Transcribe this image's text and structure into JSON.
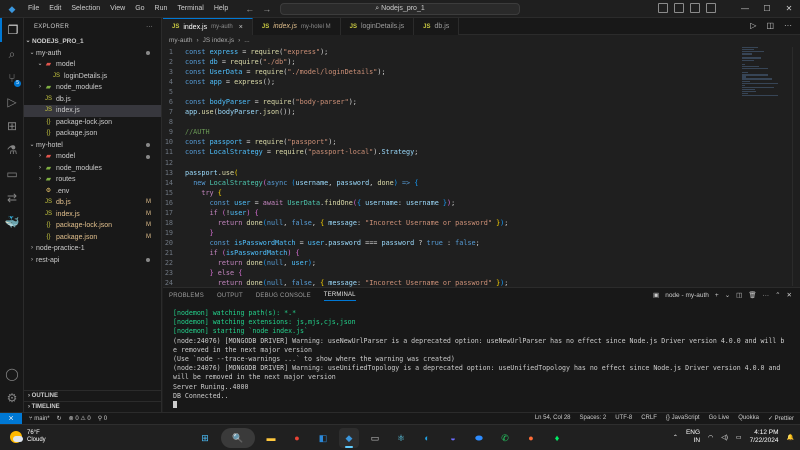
{
  "titlebar": {
    "menu": [
      "File",
      "Edit",
      "Selection",
      "View",
      "Go",
      "Run",
      "Terminal",
      "Help"
    ],
    "search": "Nodejs_pro_1"
  },
  "activitybar": {
    "scm_badge": "5"
  },
  "sidebar": {
    "title": "EXPLORER",
    "root": "NODEJS_PRO_1",
    "rows": [
      {
        "indent": 0,
        "chev": "v",
        "icon": "folder",
        "label": "my-auth",
        "mark": "",
        "color": "",
        "dot": true
      },
      {
        "indent": 1,
        "chev": "v",
        "icon": "folder-red",
        "label": "model",
        "mark": "",
        "color": ""
      },
      {
        "indent": 2,
        "chev": "",
        "icon": "js",
        "label": "loginDetails.js",
        "mark": "",
        "color": ""
      },
      {
        "indent": 1,
        "chev": ">",
        "icon": "folder-green",
        "label": "node_modules",
        "mark": "",
        "color": ""
      },
      {
        "indent": 1,
        "chev": "",
        "icon": "js",
        "label": "db.js",
        "mark": "",
        "color": ""
      },
      {
        "indent": 1,
        "chev": "",
        "icon": "js",
        "label": "index.js",
        "mark": "",
        "color": "",
        "selected": true
      },
      {
        "indent": 1,
        "chev": "",
        "icon": "json",
        "label": "package-lock.json",
        "mark": "",
        "color": ""
      },
      {
        "indent": 1,
        "chev": "",
        "icon": "json",
        "label": "package.json",
        "mark": "",
        "color": ""
      },
      {
        "indent": 0,
        "chev": "v",
        "icon": "folder",
        "label": "my-hotel",
        "mark": "",
        "color": "",
        "dot": true
      },
      {
        "indent": 1,
        "chev": ">",
        "icon": "folder-red",
        "label": "model",
        "mark": "",
        "color": "",
        "dot": true
      },
      {
        "indent": 1,
        "chev": ">",
        "icon": "folder-green",
        "label": "node_modules",
        "mark": "",
        "color": ""
      },
      {
        "indent": 1,
        "chev": ">",
        "icon": "folder-green",
        "label": "routes",
        "mark": "",
        "color": ""
      },
      {
        "indent": 1,
        "chev": "",
        "icon": "env",
        "label": ".env",
        "mark": "",
        "color": ""
      },
      {
        "indent": 1,
        "chev": "",
        "icon": "js",
        "label": "db.js",
        "mark": "M",
        "color": "yellow"
      },
      {
        "indent": 1,
        "chev": "",
        "icon": "js",
        "label": "index.js",
        "mark": "M",
        "color": "yellow"
      },
      {
        "indent": 1,
        "chev": "",
        "icon": "json",
        "label": "package-lock.json",
        "mark": "M",
        "color": "yellow"
      },
      {
        "indent": 1,
        "chev": "",
        "icon": "json",
        "label": "package.json",
        "mark": "M",
        "color": "yellow"
      },
      {
        "indent": 0,
        "chev": ">",
        "icon": "folder",
        "label": "node-practice-1",
        "mark": "",
        "color": ""
      },
      {
        "indent": 0,
        "chev": ">",
        "icon": "folder",
        "label": "rest-api",
        "mark": "",
        "color": "",
        "dot": true
      }
    ],
    "outline": "OUTLINE",
    "timeline": "TIMELINE"
  },
  "editor": {
    "tabs": [
      {
        "icon": "JS",
        "label": "index.js",
        "sub": "my-auth",
        "active": true,
        "close": "×"
      },
      {
        "icon": "JS",
        "label": "index.js",
        "sub": "my-hotel  M",
        "active": false,
        "close": ""
      },
      {
        "icon": "JS",
        "label": "loginDetails.js",
        "sub": "",
        "active": false,
        "close": ""
      },
      {
        "icon": "JS",
        "label": "db.js",
        "sub": "",
        "active": false,
        "close": ""
      }
    ],
    "breadcrumb": [
      "my-auth",
      "›",
      "JS index.js",
      "›",
      "..."
    ],
    "lines": [
      [
        [
          "kw",
          "const"
        ],
        [
          "pun",
          " "
        ],
        [
          "cst",
          "express"
        ],
        [
          "pun",
          " = "
        ],
        [
          "fn",
          "require"
        ],
        [
          "pun",
          "("
        ],
        [
          "str",
          "\"express\""
        ],
        [
          "pun",
          ");"
        ]
      ],
      [
        [
          "kw",
          "const"
        ],
        [
          "pun",
          " "
        ],
        [
          "cst",
          "db"
        ],
        [
          "pun",
          " = "
        ],
        [
          "fn",
          "require"
        ],
        [
          "pun",
          "("
        ],
        [
          "str",
          "\"./db\""
        ],
        [
          "pun",
          ");"
        ]
      ],
      [
        [
          "kw",
          "const"
        ],
        [
          "pun",
          " "
        ],
        [
          "cst",
          "UserData"
        ],
        [
          "pun",
          " = "
        ],
        [
          "fn",
          "require"
        ],
        [
          "pun",
          "("
        ],
        [
          "str",
          "\"./model/loginDetails\""
        ],
        [
          "pun",
          ");"
        ]
      ],
      [
        [
          "kw",
          "const"
        ],
        [
          "pun",
          " "
        ],
        [
          "cst",
          "app"
        ],
        [
          "pun",
          " = "
        ],
        [
          "fn",
          "express"
        ],
        [
          "pun",
          "();"
        ]
      ],
      [],
      [
        [
          "kw",
          "const"
        ],
        [
          "pun",
          " "
        ],
        [
          "cst",
          "bodyParser"
        ],
        [
          "pun",
          " = "
        ],
        [
          "fn",
          "require"
        ],
        [
          "pun",
          "("
        ],
        [
          "str",
          "\"body-parser\""
        ],
        [
          "pun",
          ");"
        ]
      ],
      [
        [
          "var",
          "app"
        ],
        [
          "pun",
          "."
        ],
        [
          "fn",
          "use"
        ],
        [
          "pun",
          "("
        ],
        [
          "var",
          "bodyParser"
        ],
        [
          "pun",
          "."
        ],
        [
          "fn",
          "json"
        ],
        [
          "pun",
          "());"
        ]
      ],
      [],
      [
        [
          "cmt",
          "//AUTH"
        ]
      ],
      [
        [
          "kw",
          "const"
        ],
        [
          "pun",
          " "
        ],
        [
          "cst",
          "passport"
        ],
        [
          "pun",
          " = "
        ],
        [
          "fn",
          "require"
        ],
        [
          "pun",
          "("
        ],
        [
          "str",
          "\"passport\""
        ],
        [
          "pun",
          ");"
        ]
      ],
      [
        [
          "kw",
          "const"
        ],
        [
          "pun",
          " "
        ],
        [
          "cst",
          "LocalStrategy"
        ],
        [
          "pun",
          " = "
        ],
        [
          "fn",
          "require"
        ],
        [
          "pun",
          "("
        ],
        [
          "str",
          "\"passport-local\""
        ],
        [
          "pun",
          ")."
        ],
        [
          "var",
          "Strategy"
        ],
        [
          "pun",
          ";"
        ]
      ],
      [],
      [
        [
          "var",
          "passport"
        ],
        [
          "pun",
          "."
        ],
        [
          "fn",
          "use"
        ],
        [
          "br1",
          "("
        ]
      ],
      [
        [
          "pun",
          "  "
        ],
        [
          "kw",
          "new"
        ],
        [
          "pun",
          " "
        ],
        [
          "cls",
          "LocalStrategy"
        ],
        [
          "br2",
          "("
        ],
        [
          "kw",
          "async"
        ],
        [
          "pun",
          " "
        ],
        [
          "br3",
          "("
        ],
        [
          "var",
          "username"
        ],
        [
          "pun",
          ", "
        ],
        [
          "var",
          "password"
        ],
        [
          "pun",
          ", "
        ],
        [
          "fn",
          "done"
        ],
        [
          "br3",
          ")"
        ],
        [
          "pun",
          " "
        ],
        [
          "kw",
          "=>"
        ],
        [
          "pun",
          " "
        ],
        [
          "br3",
          "{"
        ]
      ],
      [
        [
          "pun",
          "    "
        ],
        [
          "ctl",
          "try"
        ],
        [
          "pun",
          " "
        ],
        [
          "br1",
          "{"
        ]
      ],
      [
        [
          "pun",
          "      "
        ],
        [
          "kw",
          "const"
        ],
        [
          "pun",
          " "
        ],
        [
          "cst",
          "user"
        ],
        [
          "pun",
          " = "
        ],
        [
          "ctl",
          "await"
        ],
        [
          "pun",
          " "
        ],
        [
          "cls",
          "UserData"
        ],
        [
          "pun",
          "."
        ],
        [
          "fn",
          "findOne"
        ],
        [
          "br2",
          "("
        ],
        [
          "br3",
          "{"
        ],
        [
          "pun",
          " "
        ],
        [
          "var",
          "username"
        ],
        [
          "pun",
          ": "
        ],
        [
          "var",
          "username"
        ],
        [
          "pun",
          " "
        ],
        [
          "br3",
          "}"
        ],
        [
          "br2",
          ")"
        ],
        [
          "pun",
          ";"
        ]
      ],
      [
        [
          "pun",
          "      "
        ],
        [
          "ctl",
          "if"
        ],
        [
          "pun",
          " "
        ],
        [
          "br2",
          "("
        ],
        [
          "pun",
          "!"
        ],
        [
          "cst",
          "user"
        ],
        [
          "br2",
          ")"
        ],
        [
          "pun",
          " "
        ],
        [
          "br2",
          "{"
        ]
      ],
      [
        [
          "pun",
          "        "
        ],
        [
          "ctl",
          "return"
        ],
        [
          "pun",
          " "
        ],
        [
          "fn",
          "done"
        ],
        [
          "br3",
          "("
        ],
        [
          "kw",
          "null"
        ],
        [
          "pun",
          ", "
        ],
        [
          "kw",
          "false"
        ],
        [
          "pun",
          ", "
        ],
        [
          "br1",
          "{"
        ],
        [
          "pun",
          " "
        ],
        [
          "var",
          "message"
        ],
        [
          "pun",
          ": "
        ],
        [
          "str",
          "\"Incorect Username or password\""
        ],
        [
          "pun",
          " "
        ],
        [
          "br1",
          "}"
        ],
        [
          "br3",
          ")"
        ],
        [
          "pun",
          ";"
        ]
      ],
      [
        [
          "pun",
          "      "
        ],
        [
          "br2",
          "}"
        ]
      ],
      [
        [
          "pun",
          "      "
        ],
        [
          "kw",
          "const"
        ],
        [
          "pun",
          " "
        ],
        [
          "cst",
          "isPasswordMatch"
        ],
        [
          "pun",
          " = "
        ],
        [
          "cst",
          "user"
        ],
        [
          "pun",
          "."
        ],
        [
          "var",
          "password"
        ],
        [
          "pun",
          " === "
        ],
        [
          "var",
          "password"
        ],
        [
          "pun",
          " ? "
        ],
        [
          "kw",
          "true"
        ],
        [
          "pun",
          " : "
        ],
        [
          "kw",
          "false"
        ],
        [
          "pun",
          ";"
        ]
      ],
      [
        [
          "pun",
          "      "
        ],
        [
          "ctl",
          "if"
        ],
        [
          "pun",
          " "
        ],
        [
          "br2",
          "("
        ],
        [
          "cst",
          "isPasswordMatch"
        ],
        [
          "br2",
          ")"
        ],
        [
          "pun",
          " "
        ],
        [
          "br2",
          "{"
        ]
      ],
      [
        [
          "pun",
          "        "
        ],
        [
          "ctl",
          "return"
        ],
        [
          "pun",
          " "
        ],
        [
          "fn",
          "done"
        ],
        [
          "br3",
          "("
        ],
        [
          "kw",
          "null"
        ],
        [
          "pun",
          ", "
        ],
        [
          "cst",
          "user"
        ],
        [
          "br3",
          ")"
        ],
        [
          "pun",
          ";"
        ]
      ],
      [
        [
          "pun",
          "      "
        ],
        [
          "br2",
          "}"
        ],
        [
          "pun",
          " "
        ],
        [
          "ctl",
          "else"
        ],
        [
          "pun",
          " "
        ],
        [
          "br2",
          "{"
        ]
      ],
      [
        [
          "pun",
          "        "
        ],
        [
          "ctl",
          "return"
        ],
        [
          "pun",
          " "
        ],
        [
          "fn",
          "done"
        ],
        [
          "br3",
          "("
        ],
        [
          "kw",
          "null"
        ],
        [
          "pun",
          ", "
        ],
        [
          "kw",
          "false"
        ],
        [
          "pun",
          ", "
        ],
        [
          "br1",
          "{"
        ],
        [
          "pun",
          " "
        ],
        [
          "var",
          "message"
        ],
        [
          "pun",
          ": "
        ],
        [
          "str",
          "\"Incorect Username or password\""
        ],
        [
          "pun",
          " "
        ],
        [
          "br1",
          "}"
        ],
        [
          "br3",
          ")"
        ],
        [
          "pun",
          ";"
        ]
      ]
    ]
  },
  "panel": {
    "tabs": [
      "PROBLEMS",
      "OUTPUT",
      "DEBUG CONSOLE",
      "TERMINAL"
    ],
    "active_tab": "TERMINAL",
    "shell": "node - my-auth",
    "lines": [
      {
        "c": "tgreen",
        "t": "[nodemon] watching path(s): *.*"
      },
      {
        "c": "tgreen",
        "t": "[nodemon] watching extensions: js,mjs,cjs,json"
      },
      {
        "c": "tgreen",
        "t": "[nodemon] starting `node index.js`"
      },
      {
        "c": "",
        "t": "(node:24076) [MONGODB DRIVER] Warning: useNewUrlParser is a deprecated option: useNewUrlParser has no effect since Node.js Driver version 4.0.0 and will b"
      },
      {
        "c": "",
        "t": "e removed in the next major version"
      },
      {
        "c": "",
        "t": "(Use `node --trace-warnings ...` to show where the warning was created)"
      },
      {
        "c": "",
        "t": "(node:24076) [MONGODB DRIVER] Warning: useUnifiedTopology is a deprecated option: useUnifiedTopology has no effect since Node.js Driver version 4.0.0 and"
      },
      {
        "c": "",
        "t": "will be removed in the next major version"
      },
      {
        "c": "",
        "t": "Server Runing..4000"
      },
      {
        "c": "",
        "t": "DB Connected.."
      }
    ]
  },
  "status": {
    "branch": "main*",
    "sync": "↻",
    "problems": "⊗ 0 ⚠ 0",
    "ports": "⚲ 0",
    "right": [
      "Ln 54, Col 28",
      "Spaces: 2",
      "UTF-8",
      "CRLF",
      "{} JavaScript",
      "Go Live",
      "Quokka",
      "✓ Prettier"
    ]
  },
  "taskbar": {
    "weather_temp": "76°F",
    "weather_desc": "Cloudy",
    "lang1": "ENG",
    "lang2": "IN",
    "time": "4:12 PM",
    "date": "7/22/2024"
  },
  "colors": {
    "accent": "#0078d4",
    "modified": "#e2c08d",
    "terminal_green": "#23d18b"
  }
}
